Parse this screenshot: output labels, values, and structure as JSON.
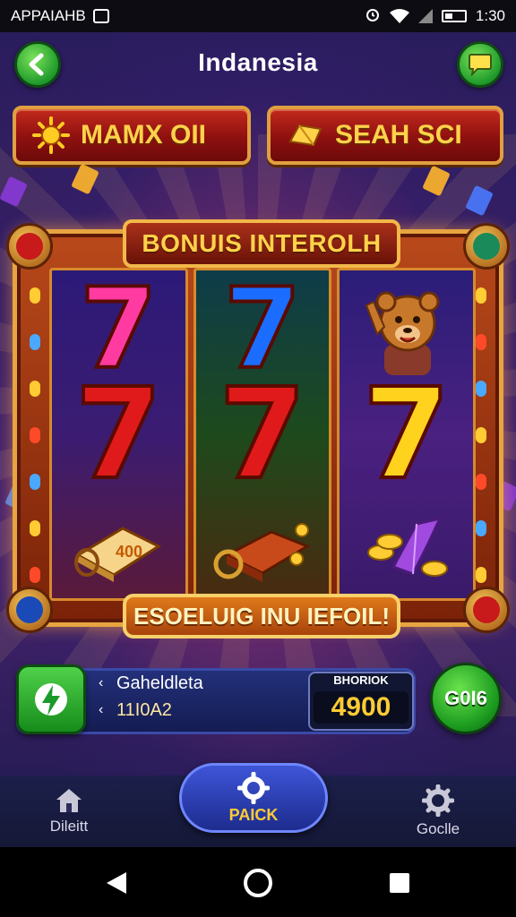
{
  "status_bar": {
    "app_label": "APPAIAHB",
    "time": "1:30"
  },
  "header": {
    "title": "Indanesia",
    "back_icon": "back-arrow-icon",
    "right_icon": "chat-icon"
  },
  "top_buttons": [
    {
      "label": "MAMX OII",
      "icon": "sun-icon"
    },
    {
      "label": "SEAH SCI",
      "icon": "gold-bar-icon"
    }
  ],
  "machine": {
    "top_banner": "BONUIS INTEROLH",
    "bottom_banner": "ESOELUIG INU IEFOIL!",
    "reels": [
      [
        "seven-magenta",
        "seven-red",
        "cash-stack"
      ],
      [
        "seven-blue",
        "seven-red",
        "treasure-scroll"
      ],
      [
        "bear-mascot",
        "seven-gold",
        "coins-purple-gem"
      ]
    ],
    "colors": {
      "frame": "#e7a441",
      "seven_red": "#e01a1a",
      "seven_gold": "#ffd21e",
      "seven_blue": "#1a6dff",
      "seven_magenta": "#ff3aa0"
    }
  },
  "info_bar": {
    "label": "Gaheldleta",
    "value": "11I0A2",
    "bet_label": "BHORIOK",
    "bet_value": "4900",
    "go_label": "G0I6"
  },
  "bottom_nav": {
    "home_label": "Dileitt",
    "center_label": "PAICK",
    "settings_label": "Goclle"
  }
}
